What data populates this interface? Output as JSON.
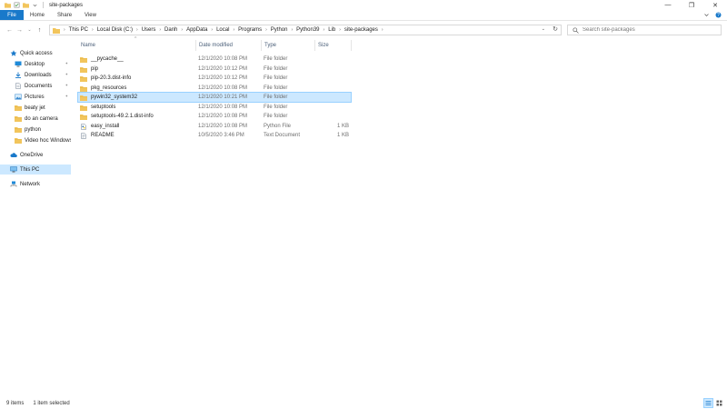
{
  "window": {
    "title": "site-packages",
    "minimize": "—",
    "maximize": "❐",
    "close": "✕"
  },
  "ribbon": {
    "tabs": [
      "File",
      "Home",
      "Share",
      "View"
    ]
  },
  "address": {
    "crumbs": [
      "This PC",
      "Local Disk (C:)",
      "Users",
      "Danh",
      "AppData",
      "Local",
      "Programs",
      "Python",
      "Python39",
      "Lib",
      "site-packages"
    ],
    "search_placeholder": "Search site-packages"
  },
  "nav": {
    "items": [
      {
        "label": "Quick access",
        "icon": "star-icon",
        "indent": 0,
        "pinned": false
      },
      {
        "label": "Desktop",
        "icon": "desktop-icon",
        "indent": 1,
        "pinned": true
      },
      {
        "label": "Downloads",
        "icon": "download-icon",
        "indent": 1,
        "pinned": true
      },
      {
        "label": "Documents",
        "icon": "document-icon",
        "indent": 1,
        "pinned": true
      },
      {
        "label": "Pictures",
        "icon": "pictures-icon",
        "indent": 1,
        "pinned": true
      },
      {
        "label": "beaty jet",
        "icon": "folder-icon",
        "indent": 1,
        "pinned": false
      },
      {
        "label": "do an camera",
        "icon": "folder-icon",
        "indent": 1,
        "pinned": false
      },
      {
        "label": "python",
        "icon": "folder-icon",
        "indent": 1,
        "pinned": false
      },
      {
        "label": "Video hoc Windows",
        "icon": "folder-icon",
        "indent": 1,
        "pinned": false
      },
      {
        "label": "OneDrive",
        "icon": "cloud-icon",
        "indent": 0,
        "pinned": false
      },
      {
        "label": "This PC",
        "icon": "computer-icon",
        "indent": 0,
        "pinned": false,
        "selected": true
      },
      {
        "label": "Network",
        "icon": "network-icon",
        "indent": 0,
        "pinned": false
      }
    ]
  },
  "columns": {
    "name": "Name",
    "date": "Date modified",
    "type": "Type",
    "size": "Size"
  },
  "files": [
    {
      "name": "__pycache__",
      "date": "12/1/2020 10:08 PM",
      "type": "File folder",
      "size": "",
      "icon": "folder-icon"
    },
    {
      "name": "pip",
      "date": "12/1/2020 10:12 PM",
      "type": "File folder",
      "size": "",
      "icon": "folder-icon"
    },
    {
      "name": "pip-20.3.dist-info",
      "date": "12/1/2020 10:12 PM",
      "type": "File folder",
      "size": "",
      "icon": "folder-icon"
    },
    {
      "name": "pkg_resources",
      "date": "12/1/2020 10:08 PM",
      "type": "File folder",
      "size": "",
      "icon": "folder-icon"
    },
    {
      "name": "pywin32_system32",
      "date": "12/1/2020 10:21 PM",
      "type": "File folder",
      "size": "",
      "icon": "folder-icon",
      "selected": true
    },
    {
      "name": "setuptools",
      "date": "12/1/2020 10:08 PM",
      "type": "File folder",
      "size": "",
      "icon": "folder-icon"
    },
    {
      "name": "setuptools-49.2.1.dist-info",
      "date": "12/1/2020 10:08 PM",
      "type": "File folder",
      "size": "",
      "icon": "folder-icon"
    },
    {
      "name": "easy_install",
      "date": "12/1/2020 10:08 PM",
      "type": "Python File",
      "size": "1 KB",
      "icon": "python-file-icon"
    },
    {
      "name": "README",
      "date": "10/5/2020 3:46 PM",
      "type": "Text Document",
      "size": "1 KB",
      "icon": "text-file-icon"
    }
  ],
  "status": {
    "items": "9 items",
    "selected": "1 item selected"
  },
  "colors": {
    "accent": "#1979ca",
    "selection": "#cce8ff",
    "folder": "#f2c55c"
  }
}
